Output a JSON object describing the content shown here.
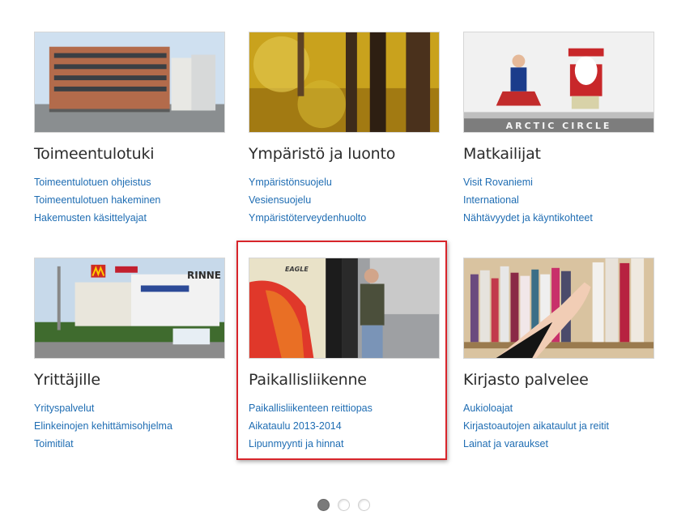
{
  "cards": [
    {
      "title": "Toimeentulotuki",
      "image": "office-building-photo",
      "links": [
        "Toimeentulotuen ohjeistus",
        "Toimeentulotuen hakeminen",
        "Hakemusten käsittelyajat"
      ]
    },
    {
      "title": "Ympäristö ja luonto",
      "image": "autumn-forest-photo",
      "links": [
        "Ympäristönsuojelu",
        "Vesiensuojelu",
        "Ympäristöterveydenhuolto"
      ]
    },
    {
      "title": "Matkailijat",
      "image": "arctic-circle-santa-photo",
      "image_text": "ARCTIC CIRCLE",
      "links": [
        "Visit Rovaniemi",
        "International",
        "Nähtävyydet ja käyntikohteet"
      ]
    },
    {
      "title": "Yrittäjille",
      "image": "commercial-area-photo",
      "image_text": "RINNE",
      "links": [
        "Yrityspalvelut",
        "Elinkeinojen kehittämisohjelma",
        "Toimitilat"
      ]
    },
    {
      "title": "Paikallisliikenne",
      "image": "bus-passenger-photo",
      "image_text": "EAGLE",
      "links": [
        "Paikallisliikenteen reittiopas",
        "Aikataulu 2013-2014",
        "Lipunmyynti ja hinnat"
      ]
    },
    {
      "title": "Kirjasto palvelee",
      "image": "library-bookshelf-photo",
      "links": [
        "Aukioloajat",
        "Kirjastoautojen aikataulut ja reitit",
        "Lainat ja varaukset"
      ]
    }
  ],
  "highlighted_card": "Paikallisliikenne",
  "pager": {
    "pages": 3,
    "active": 1
  },
  "colors": {
    "link": "#1f6db3",
    "title": "#2c2c2c",
    "highlight": "#d8252b"
  }
}
